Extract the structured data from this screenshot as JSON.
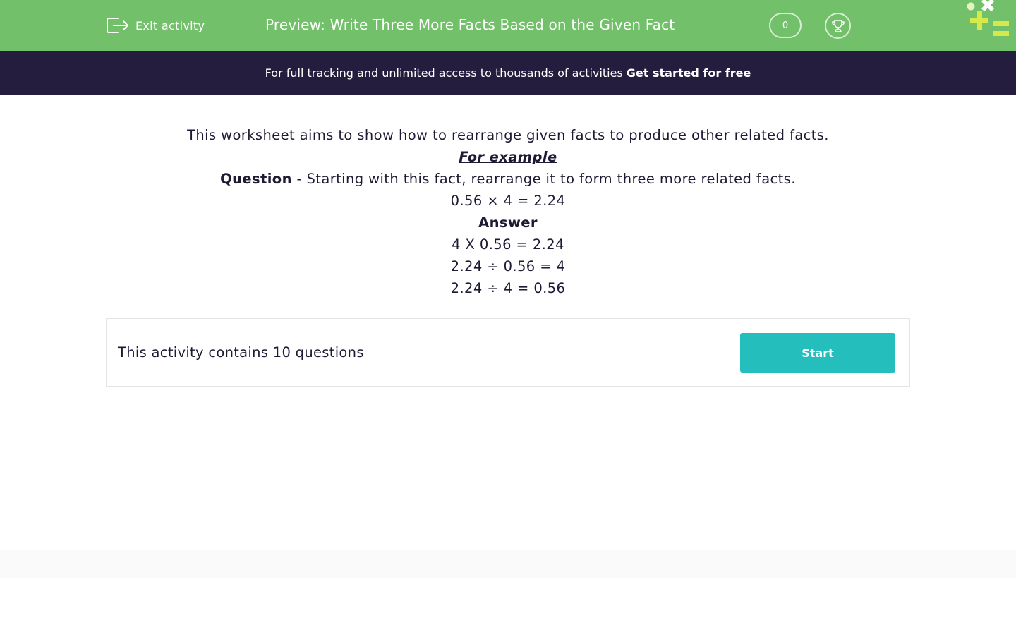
{
  "header": {
    "exit_label": "Exit activity",
    "title": "Preview: Write Three More Facts Based on the Given Fact",
    "score": "0"
  },
  "promo": {
    "text": "For full tracking and unlimited access to thousands of activities",
    "link": "Get started for free"
  },
  "intro": {
    "description": "This worksheet aims to show how to rearrange given facts to produce other related facts.",
    "example_heading": "For example",
    "question_label": "Question",
    "question_text": "- Starting with this fact, rearrange it to form three more related facts.",
    "given_fact": "0.56 × 4 = 2.24",
    "answer_label": "Answer",
    "answers": [
      "4 X 0.56 = 2.24",
      "2.24 ÷ 0.56 = 4",
      "2.24 ÷ 4 = 0.56"
    ]
  },
  "activity": {
    "info": "This activity contains 10 questions",
    "start_label": "Start"
  },
  "colors": {
    "header_green": "#72c06a",
    "promo_navy": "#241d3d",
    "start_teal": "#24bfbd",
    "text_dark": "#1f1a33"
  },
  "icons": {
    "exit": "exit-icon",
    "trophy": "trophy-icon",
    "brand": "brand-logo-icon"
  }
}
